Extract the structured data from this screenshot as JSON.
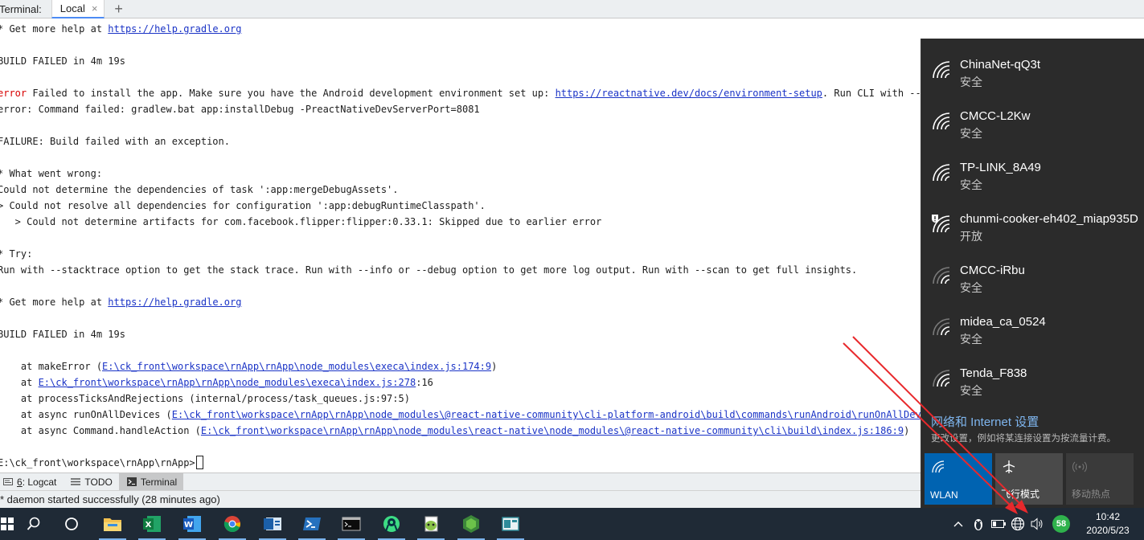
{
  "tabbar": {
    "label": "Terminal:",
    "tab": "Local",
    "tab_close": "×",
    "add": "+"
  },
  "terminal": {
    "l1_a": "* Get more help at ",
    "l1_link": "https://help.gradle.org",
    "l2": "BUILD FAILED in 4m 19s",
    "l3_red": "error",
    "l3_a": " Failed to install the app. Make sure you have the Android development environment set up: ",
    "l3_link": "https://reactnative.dev/docs/environment-setup",
    "l3_b": ". Run CLI with --verbose",
    "l4": "error: Command failed: gradlew.bat app:installDebug -PreactNativeDevServerPort=8081",
    "l5": "FAILURE: Build failed with an exception.",
    "l6": "* What went wrong:",
    "l7": "Could not determine the dependencies of task ':app:mergeDebugAssets'.",
    "l8": "> Could not resolve all dependencies for configuration ':app:debugRuntimeClasspath'.",
    "l9": "   > Could not determine artifacts for com.facebook.flipper:flipper:0.33.1: Skipped due to earlier error",
    "l10": "* Try:",
    "l11": "Run with --stacktrace option to get the stack trace. Run with --info or --debug option to get more log output. Run with --scan to get full insights.",
    "l12_a": "* Get more help at ",
    "l12_link": "https://help.gradle.org",
    "l13": "BUILD FAILED in 4m 19s",
    "l14_a": "    at makeError (",
    "l14_link": "E:\\ck_front\\workspace\\rnApp\\rnApp\\node_modules\\execa\\index.js:174:9",
    "l14_b": ")",
    "l15_a": "    at ",
    "l15_link": "E:\\ck_front\\workspace\\rnApp\\rnApp\\node_modules\\execa\\index.js:278",
    "l15_b": ":16",
    "l16": "    at processTicksAndRejections (internal/process/task_queues.js:97:5)",
    "l17_a": "    at async runOnAllDevices (",
    "l17_link": "E:\\ck_front\\workspace\\rnApp\\rnApp\\node_modules\\@react-native-community\\cli-platform-android\\build\\commands\\runAndroid\\runOnAllDevices",
    "l18_a": "    at async Command.handleAction (",
    "l18_link": "E:\\ck_front\\workspace\\rnApp\\rnApp\\node_modules\\react-native\\node_modules\\@react-native-community\\cli\\build\\index.js:186:9",
    "l18_b": ")",
    "prompt": "E:\\ck_front\\workspace\\rnApp\\rnApp>"
  },
  "tools": {
    "logcat_num": "6",
    "logcat": ": Logcat",
    "todo": "TODO",
    "terminal": "Terminal"
  },
  "status": "* daemon started successfully (28 minutes ago)",
  "flyout": {
    "networks": [
      {
        "ssid": "ChinaNet-qQ3t",
        "security": "安全",
        "icon": "wifi-icon"
      },
      {
        "ssid": "CMCC-L2Kw",
        "security": "安全",
        "icon": "wifi-icon"
      },
      {
        "ssid": "TP-LINK_8A49",
        "security": "安全",
        "icon": "wifi-icon"
      },
      {
        "ssid": "chunmi-cooker-eh402_miap935D",
        "security": "开放",
        "icon": "wifi-open-shield-icon"
      },
      {
        "ssid": "CMCC-iRbu",
        "security": "安全",
        "icon": "wifi-weak-icon"
      },
      {
        "ssid": "midea_ca_0524",
        "security": "安全",
        "icon": "wifi-weak-icon"
      },
      {
        "ssid": "Tenda_F838",
        "security": "安全",
        "icon": "wifi-icon"
      }
    ],
    "settings_link": "网络和 Internet 设置",
    "settings_desc": "更改设置，例如将某连接设置为按流量计费。",
    "quick": {
      "wlan": "WLAN",
      "airplane": "飞行模式",
      "hotspot": "移动热点"
    }
  },
  "taskbar": {
    "badge": "58",
    "time": "10:42",
    "date": "2020/5/23",
    "icons": [
      "windows-start-icon",
      "search-icon",
      "task-view-icon",
      "file-explorer-icon",
      "excel-icon",
      "word-icon",
      "chrome-icon",
      "outlook-icon",
      "powershell-icon",
      "cmd-icon",
      "android-studio-icon",
      "notepad-plus-icon",
      "nodejs-icon",
      "app-icon"
    ]
  },
  "colors": {
    "error_red": "#d70000",
    "link_blue": "#1a33c6",
    "accent": "#0063b1",
    "flyout_bg": "#2b2b2b",
    "taskbar_bg": "#1f2a36"
  }
}
